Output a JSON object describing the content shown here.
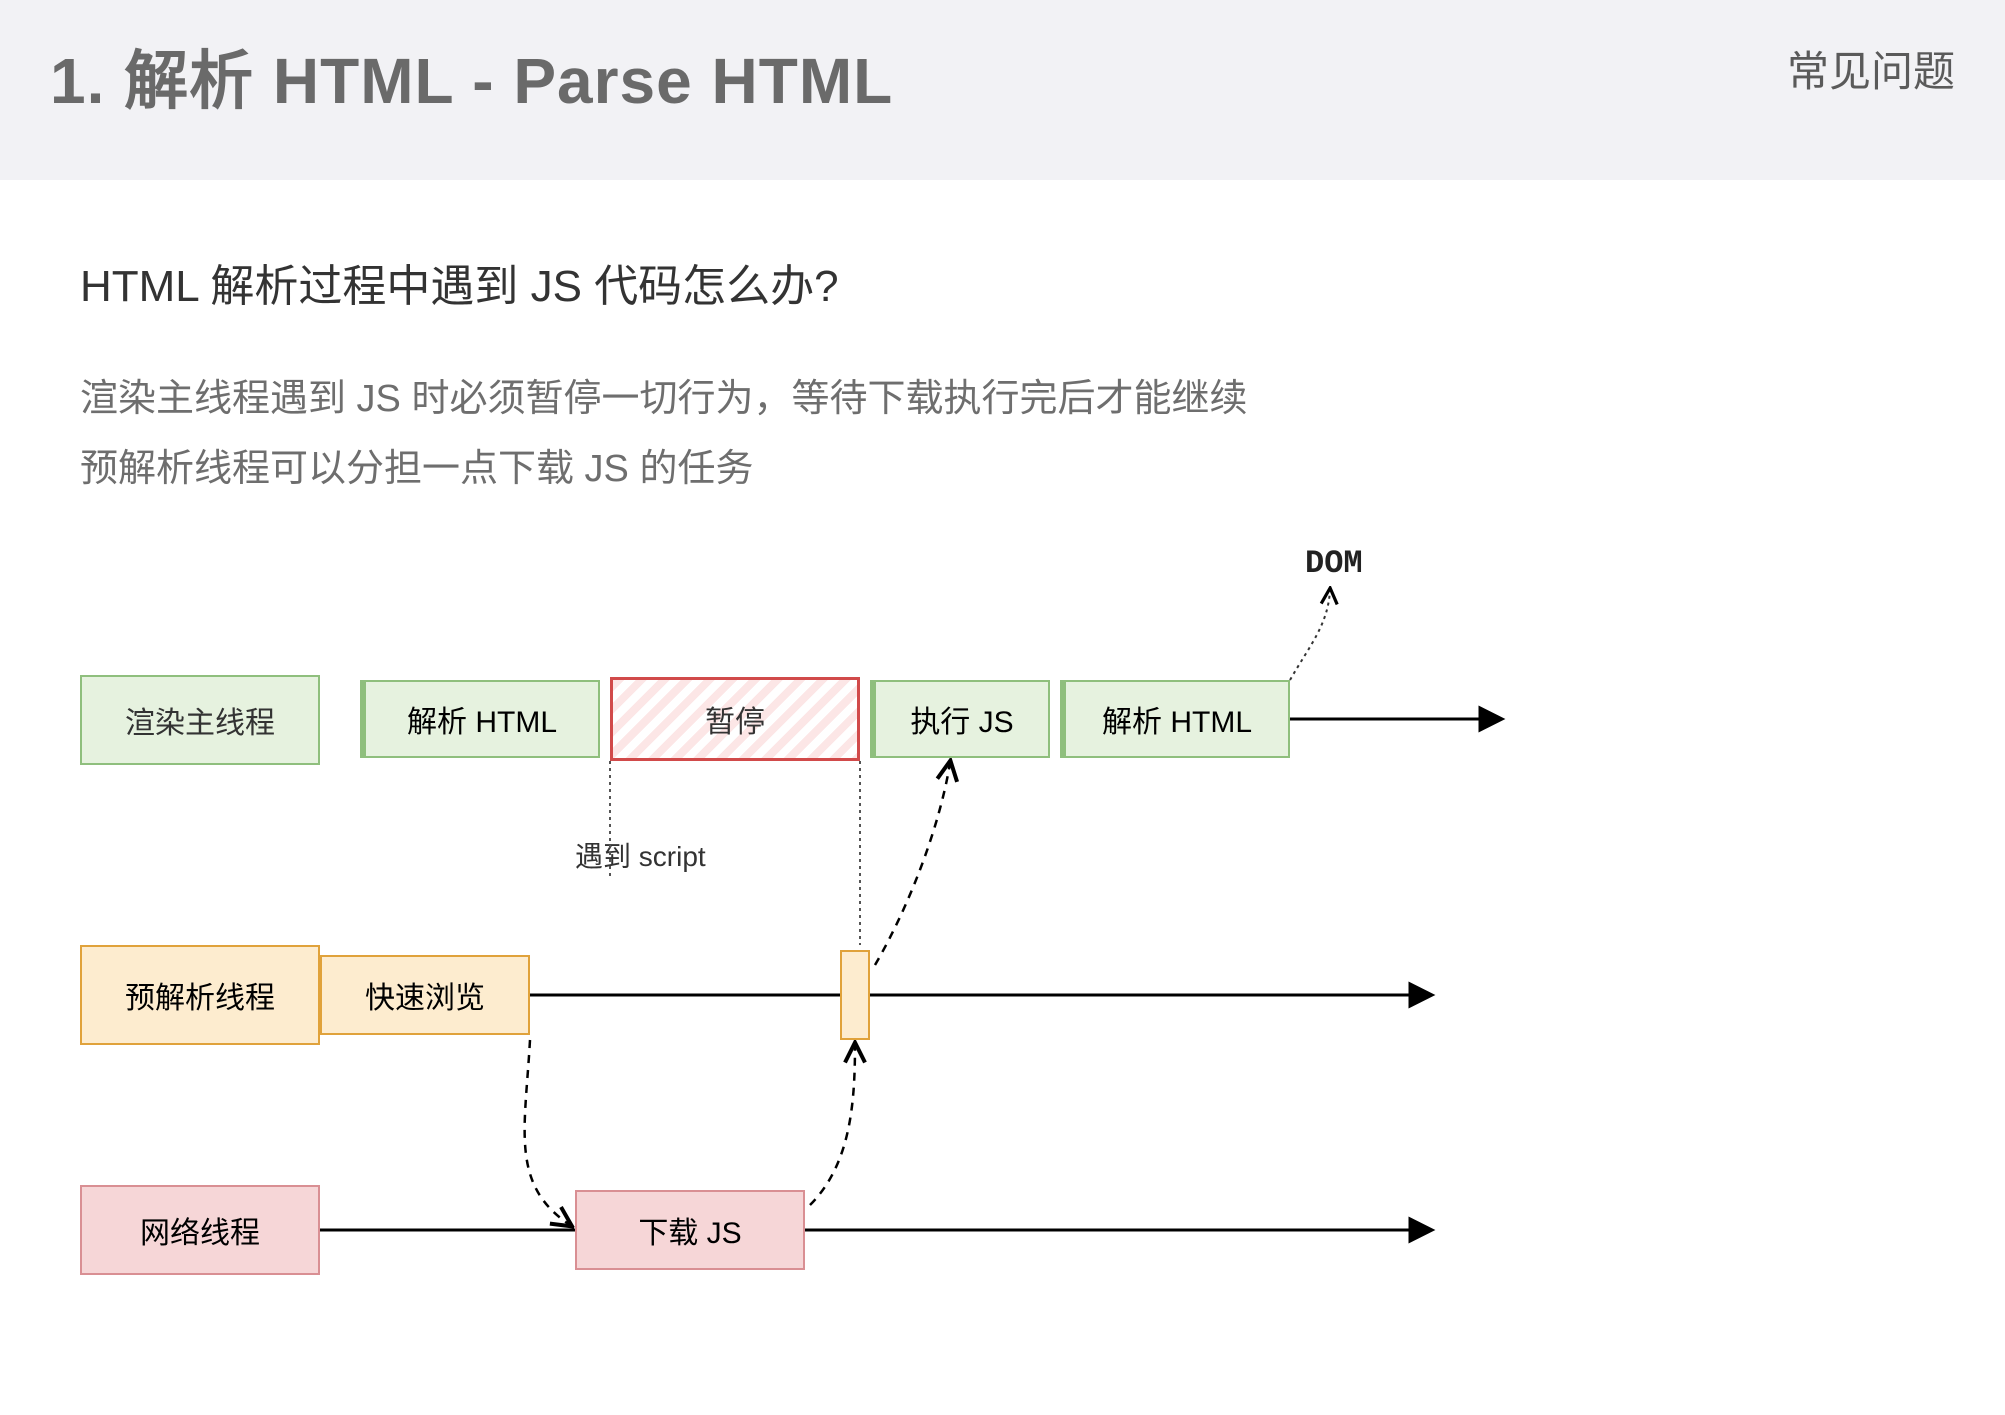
{
  "header": {
    "title": "1. 解析 HTML - Parse HTML",
    "tag": "常见问题"
  },
  "question": "HTML 解析过程中遇到 JS 代码怎么办?",
  "description_line1": "渲染主线程遇到 JS 时必须暂停一切行为，等待下载执行完后才能继续",
  "description_line2": "预解析线程可以分担一点下载 JS 的任务",
  "lanes": {
    "render_main": "渲染主线程",
    "preparse": "预解析线程",
    "network": "网络线程"
  },
  "blocks": {
    "parse_html_1": "解析 HTML",
    "pause": "暂停",
    "exec_js": "执行 JS",
    "parse_html_2": "解析 HTML",
    "quick_scan": "快速浏览",
    "download_js": "下载 JS"
  },
  "labels": {
    "dom": "DOM",
    "encounter_script": "遇到 script"
  }
}
